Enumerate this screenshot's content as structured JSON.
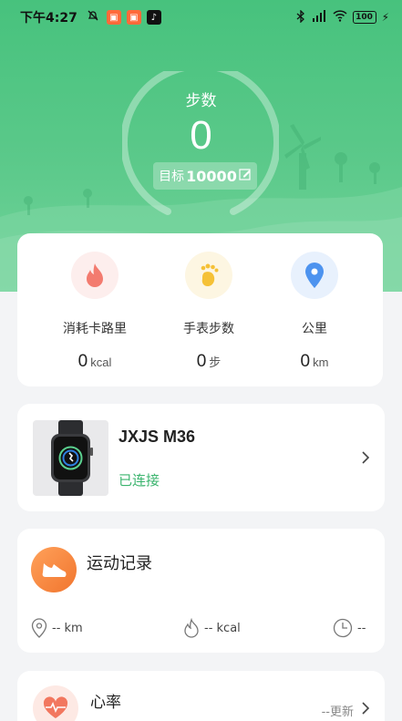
{
  "status_bar": {
    "time": "下午4:27",
    "signal": "4G",
    "battery": "100"
  },
  "hero": {
    "steps_label": "步数",
    "steps_value": "0",
    "goal_label": "目标",
    "goal_value": "10000",
    "ring_progress": 0
  },
  "stats": [
    {
      "icon": "flame-icon",
      "label": "消耗卡路里",
      "value": "0",
      "unit": "kcal"
    },
    {
      "icon": "footprint-icon",
      "label": "手表步数",
      "value": "0",
      "unit": "步"
    },
    {
      "icon": "location-pin-icon",
      "label": "公里",
      "value": "0",
      "unit": "km"
    }
  ],
  "device": {
    "name": "JXJS M36",
    "status": "已连接"
  },
  "exercise_record": {
    "title": "运动记录",
    "distance": "-- km",
    "calories": "-- kcal",
    "duration": "--"
  },
  "heart_rate": {
    "title": "心率",
    "update": "--更新"
  },
  "colors": {
    "brand_green": "#47c27d",
    "connected_green": "#3bb46e",
    "orange": "#f1752e"
  }
}
